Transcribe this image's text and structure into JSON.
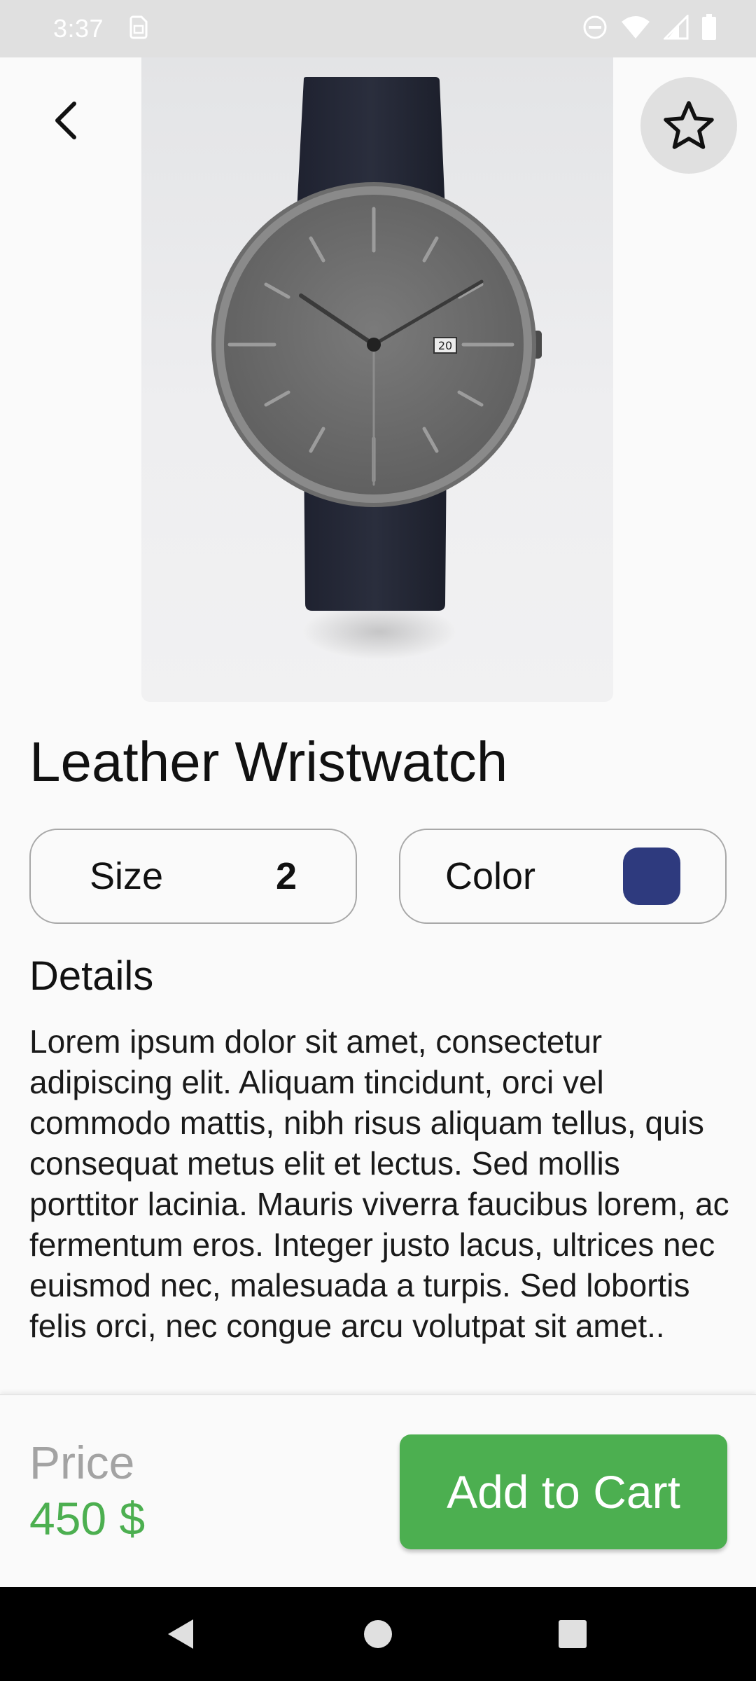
{
  "status_bar": {
    "time": "3:37"
  },
  "product": {
    "title": "Leather Wristwatch",
    "image_icon": "watch-image",
    "date_window": "20"
  },
  "options": {
    "size_label": "Size",
    "size_value": "2",
    "color_label": "Color",
    "color_value": "#2e3a7e"
  },
  "details": {
    "heading": "Details",
    "text": "Lorem ipsum dolor sit amet, consectetur adipiscing elit. Aliquam tincidunt, orci vel commodo mattis, nibh risus aliquam tellus, quis consequat metus elit et lectus. Sed mollis porttitor lacinia. Mauris viverra faucibus lorem, ac fermentum eros. Integer justo lacus, ultrices nec euismod nec, malesuada a turpis. Sed lobortis felis orci, nec congue arcu volutpat sit amet.."
  },
  "footer": {
    "price_label": "Price",
    "price_value": "450 $",
    "cart_button_label": "Add to Cart"
  },
  "colors": {
    "accent": "#4caf50",
    "swatch": "#2e3a7e",
    "status_bar_bg": "#e0e0e0",
    "nav_bar_bg": "#000000"
  },
  "icons": {
    "back": "arrow-back-icon",
    "favorite": "star-outline-icon",
    "nav_back": "nav-back-icon",
    "nav_home": "nav-home-icon",
    "nav_recents": "nav-recents-icon"
  }
}
